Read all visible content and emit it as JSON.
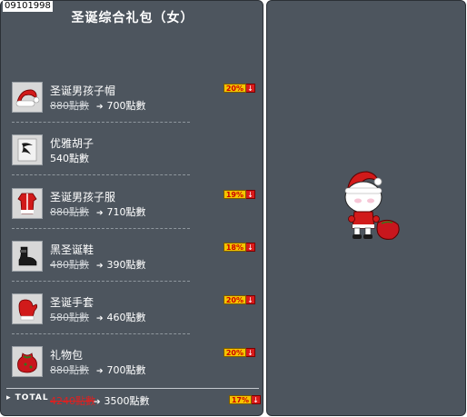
{
  "header": {
    "code": "09101998",
    "title": "圣诞综合礼包（女）"
  },
  "items": [
    {
      "name": "圣诞男孩子帽",
      "old_price": "880點數",
      "new_price": "700點數",
      "discount": "20%",
      "icon": "santa-hat-icon"
    },
    {
      "name": "优雅胡子",
      "old_price": "",
      "new_price": "540點數",
      "discount": "",
      "icon": "mustache-icon"
    },
    {
      "name": "圣诞男孩子服",
      "old_price": "880點數",
      "new_price": "710點數",
      "discount": "19%",
      "icon": "santa-suit-icon"
    },
    {
      "name": "黑圣诞鞋",
      "old_price": "480點數",
      "new_price": "390點數",
      "discount": "18%",
      "icon": "black-shoe-icon"
    },
    {
      "name": "圣诞手套",
      "old_price": "580點數",
      "new_price": "460點數",
      "discount": "20%",
      "icon": "red-glove-icon"
    },
    {
      "name": "礼物包",
      "old_price": "880點數",
      "new_price": "700點數",
      "discount": "20%",
      "icon": "gift-bag-icon"
    }
  ],
  "total": {
    "label": "TOTAL",
    "old_price": "4240點數",
    "new_price": "3500點數",
    "discount": "17%"
  },
  "colors": {
    "panel": "#4d555e",
    "badge": "#f5c400",
    "accent_red": "#d91a1a"
  }
}
